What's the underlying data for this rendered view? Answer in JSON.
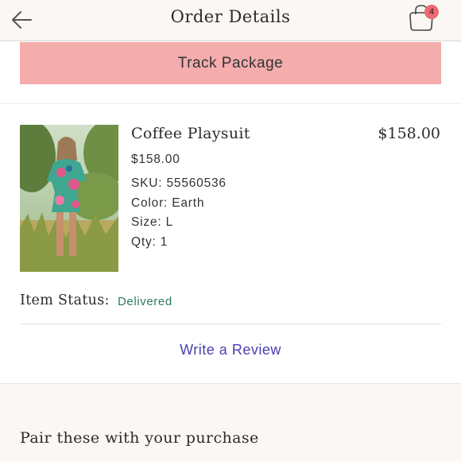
{
  "header": {
    "title": "Order Details",
    "back_icon": "arrow-left-icon",
    "cart_icon": "shopping-bag-icon",
    "cart_count": "4"
  },
  "track": {
    "label": "Track Package"
  },
  "item": {
    "image_icon": "product-photo",
    "name": "Coffee Playsuit",
    "total": "$158.00",
    "price": "$158.00",
    "sku": "SKU: 55560536",
    "color": "Color: Earth",
    "size": "Size: L",
    "qty": "Qty: 1",
    "status_label": "Item Status:",
    "status_value": "Delivered"
  },
  "review": {
    "label": "Write a Review"
  },
  "recommendations": {
    "title": "Pair these with your purchase"
  },
  "colors": {
    "track_button": "#f4acac",
    "status_delivered": "#2e7d5b",
    "review_link": "#4a3fb0",
    "badge": "#e96b6f"
  }
}
